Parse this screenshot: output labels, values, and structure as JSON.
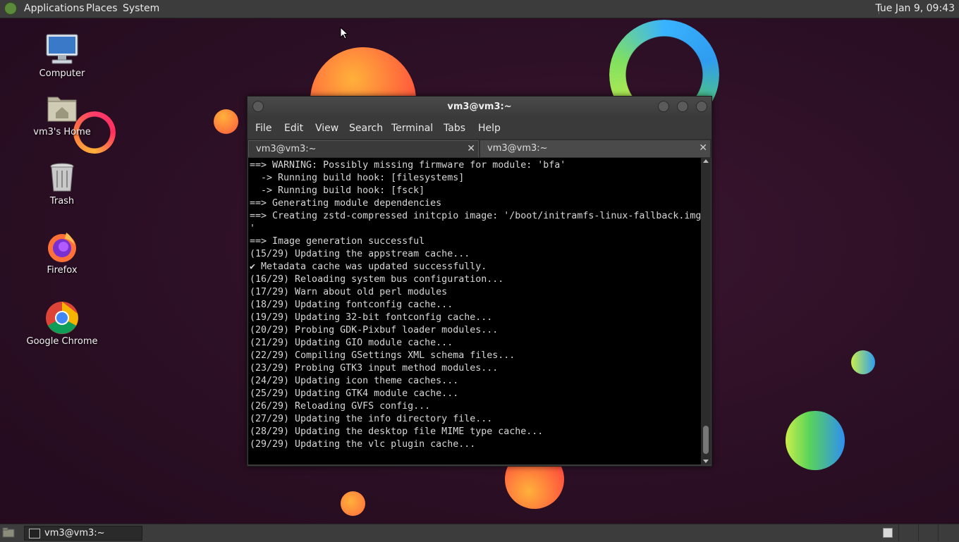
{
  "top_panel": {
    "menus": [
      "Applications",
      "Places",
      "System"
    ],
    "clock": "Tue Jan  9, 09:43"
  },
  "desktop_icons": [
    {
      "label": "Computer",
      "icon": "computer-icon"
    },
    {
      "label": "vm3's Home",
      "icon": "home-folder-icon"
    },
    {
      "label": "Trash",
      "icon": "trash-icon"
    },
    {
      "label": "Firefox",
      "icon": "firefox-icon"
    },
    {
      "label": "Google Chrome",
      "icon": "chrome-icon"
    }
  ],
  "terminal": {
    "title": "vm3@vm3:~",
    "menu": [
      "File",
      "Edit",
      "View",
      "Search",
      "Terminal",
      "Tabs",
      "Help"
    ],
    "tabs": [
      {
        "label": "vm3@vm3:~",
        "active": true
      },
      {
        "label": "vm3@vm3:~",
        "active": false
      }
    ],
    "lines": [
      "==> WARNING: Possibly missing firmware for module: 'bfa'",
      "  -> Running build hook: [filesystems]",
      "  -> Running build hook: [fsck]",
      "==> Generating module dependencies",
      "==> Creating zstd-compressed initcpio image: '/boot/initramfs-linux-fallback.img",
      "'",
      "==> Image generation successful",
      "(15/29) Updating the appstream cache...",
      "✔ Metadata cache was updated successfully.",
      "(16/29) Reloading system bus configuration...",
      "(17/29) Warn about old perl modules",
      "(18/29) Updating fontconfig cache...",
      "(19/29) Updating 32-bit fontconfig cache...",
      "(20/29) Probing GDK-Pixbuf loader modules...",
      "(21/29) Updating GIO module cache...",
      "(22/29) Compiling GSettings XML schema files...",
      "(23/29) Probing GTK3 input method modules...",
      "(24/29) Updating icon theme caches...",
      "(25/29) Updating GTK4 module cache...",
      "(26/29) Reloading GVFS config...",
      "(27/29) Updating the info directory file...",
      "(28/29) Updating the desktop file MIME type cache...",
      "(29/29) Updating the vlc plugin cache..."
    ]
  },
  "bottom_panel": {
    "task_label": "vm3@vm3:~"
  },
  "colors": {
    "panel_bg": "#3c3c3c",
    "desktop_bg": "#2b0f24",
    "terminal_bg": "#000000",
    "terminal_fg": "#d7d7d7"
  }
}
